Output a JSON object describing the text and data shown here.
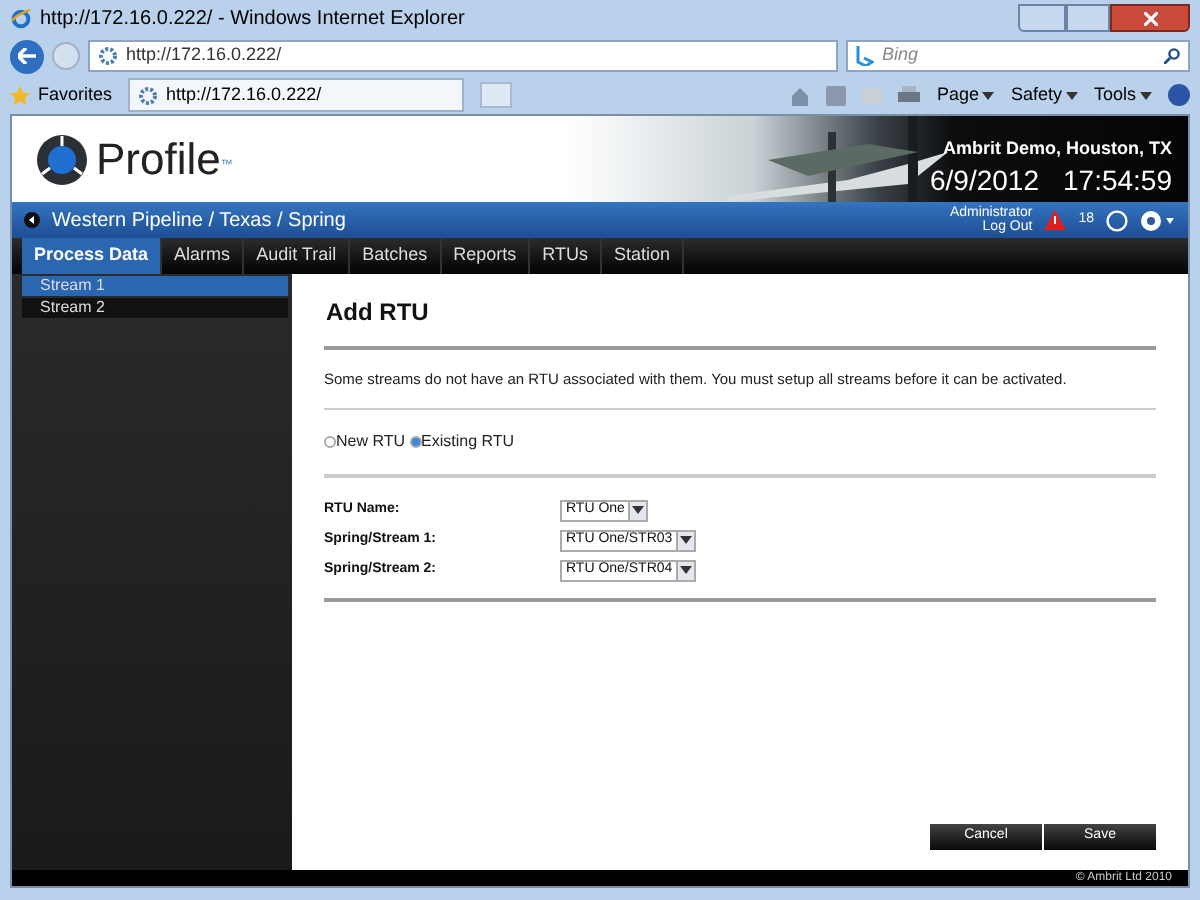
{
  "browser": {
    "title": "http://172.16.0.222/ - Windows Internet Explorer",
    "address": "http://172.16.0.222/",
    "search_placeholder": "Bing",
    "favorites": "Favorites",
    "tab": "http://172.16.0.222/",
    "commands": [
      "Page",
      "Safety",
      "Tools"
    ]
  },
  "header": {
    "logo": "Profile",
    "trademark": "™",
    "site": "Ambrit Demo, Houston, TX",
    "date": "6/9/2012",
    "time": "17:54:59"
  },
  "bar": {
    "breadcrumb": "Western Pipeline / Texas / Spring",
    "user": "Administrator",
    "logout": "Log Out",
    "alert_count": "18"
  },
  "nav": [
    {
      "label": "Process Data",
      "selected": true
    },
    {
      "label": "Alarms",
      "selected": false
    },
    {
      "label": "Audit Trail",
      "selected": false
    },
    {
      "label": "Batches",
      "selected": false
    },
    {
      "label": "Reports",
      "selected": false
    },
    {
      "label": "RTUs",
      "selected": false
    },
    {
      "label": "Station",
      "selected": false
    }
  ],
  "sidebar": {
    "items": [
      {
        "label": "Stream 1",
        "selected": true
      },
      {
        "label": "Stream 2",
        "selected": false
      }
    ]
  },
  "form": {
    "title": "Add RTU",
    "message": "Some streams do not have an RTU associated with them. You must setup all streams before it can be activated.",
    "radios": [
      {
        "label": "New RTU",
        "selected": false
      },
      {
        "label": "Existing RTU",
        "selected": true
      }
    ],
    "fields": [
      {
        "label": "RTU Name:",
        "value": "RTU One"
      },
      {
        "label": "Spring/Stream 1:",
        "value": "RTU One/STR03"
      },
      {
        "label": "Spring/Stream 2:",
        "value": "RTU One/STR04"
      }
    ],
    "buttons": [
      "Cancel",
      "Save"
    ]
  },
  "footer": "© Ambrit Ltd 2010"
}
